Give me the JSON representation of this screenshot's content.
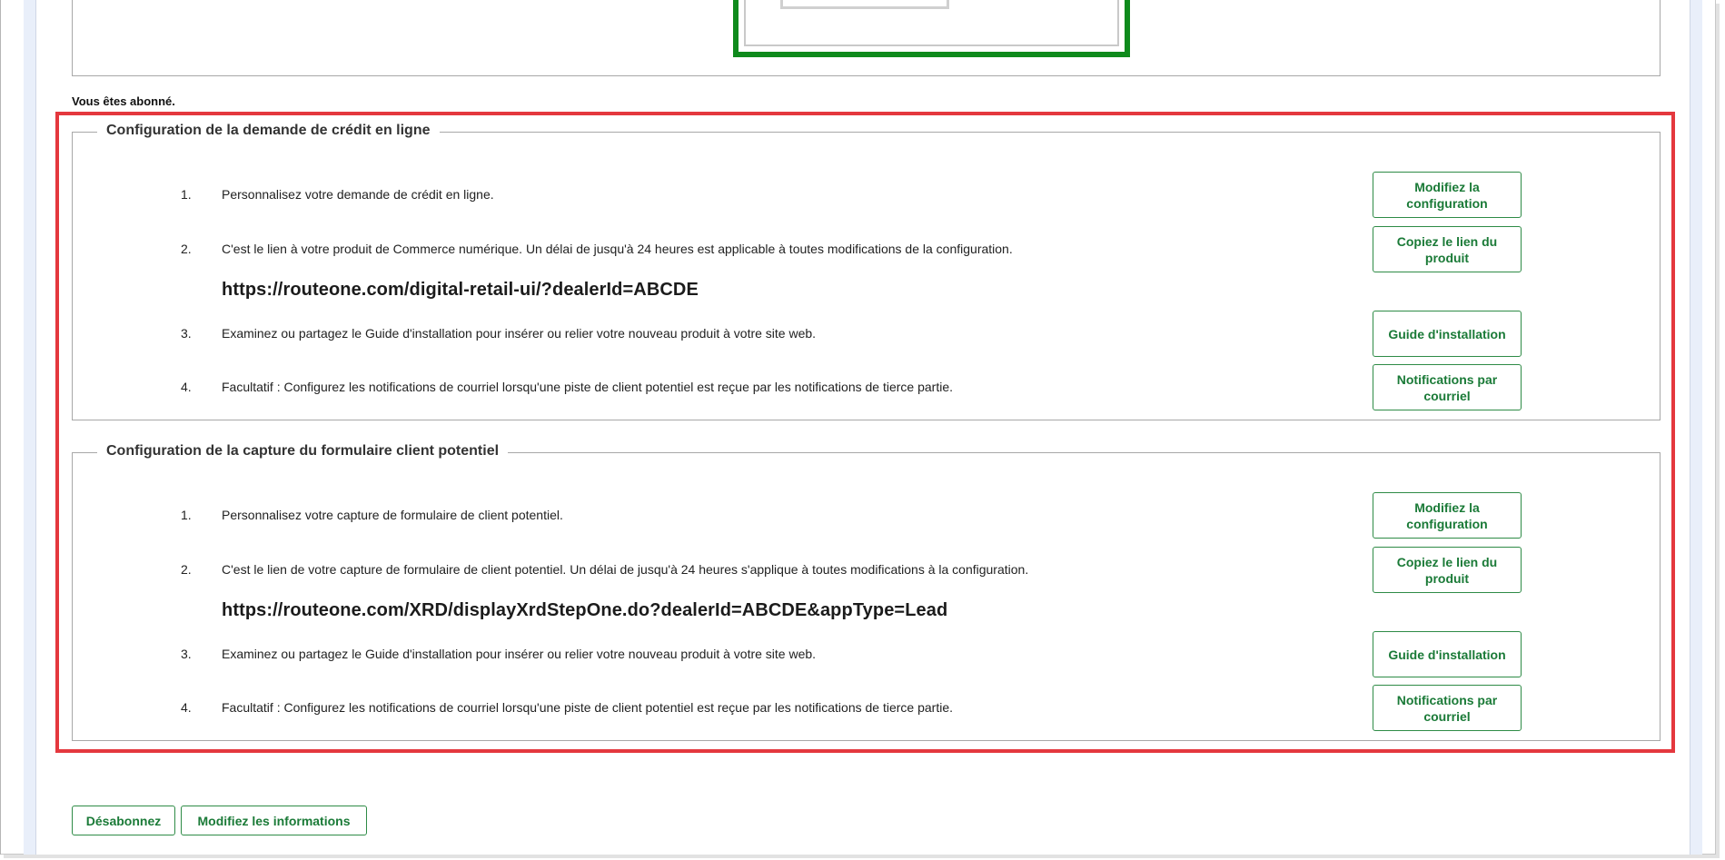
{
  "status_text": "Vous êtes abonné.",
  "sections": [
    {
      "title": "Configuration de la demande de crédit en ligne",
      "steps": [
        {
          "num": "1.",
          "text": "Personnalisez votre demande de crédit en ligne.",
          "button": "Modifiez la configuration"
        },
        {
          "num": "2.",
          "text": "C'est le lien à votre produit de Commerce numérique. Un délai de jusqu'à 24 heures est applicable à toutes modifications de la configuration.",
          "button": "Copiez le lien du produit"
        },
        {
          "num": "3.",
          "text": "Examinez ou partagez le Guide d'installation pour insérer ou relier votre nouveau produit à votre site web.",
          "button": "Guide d'installation"
        },
        {
          "num": "4.",
          "text": "Facultatif : Configurez les notifications de courriel lorsqu'une piste de client potentiel est reçue par les notifications de tierce partie.",
          "button": "Notifications par courriel"
        }
      ],
      "url": "https://routeone.com/digital-retail-ui/?dealerId=ABCDE"
    },
    {
      "title": "Configuration de la capture du formulaire client potentiel",
      "steps": [
        {
          "num": "1.",
          "text": "Personnalisez votre capture de formulaire de client potentiel.",
          "button": "Modifiez la configuration"
        },
        {
          "num": "2.",
          "text": "C'est le lien de votre capture de formulaire de client potentiel. Un délai de jusqu'à 24 heures s'applique à toutes modifications à la configuration.",
          "button": "Copiez le lien du produit"
        },
        {
          "num": "3.",
          "text": "Examinez ou partagez le Guide d'installation pour insérer ou relier votre nouveau produit à votre site web.",
          "button": "Guide d'installation"
        },
        {
          "num": "4.",
          "text": "Facultatif : Configurez les notifications de courriel lorsqu'une piste de client potentiel est reçue par les notifications de tierce partie.",
          "button": "Notifications par courriel"
        }
      ],
      "url": "https://routeone.com/XRD/displayXrdStepOne.do?dealerId=ABCDE&appType=Lead"
    }
  ],
  "footer": {
    "unsubscribe_label": "Désabonnez",
    "edit_info_label": "Modifiez les informations"
  },
  "colors": {
    "accent_green": "#1a7a37",
    "highlight_red": "#e4383e",
    "preview_frame_green": "#0f8a1c"
  }
}
